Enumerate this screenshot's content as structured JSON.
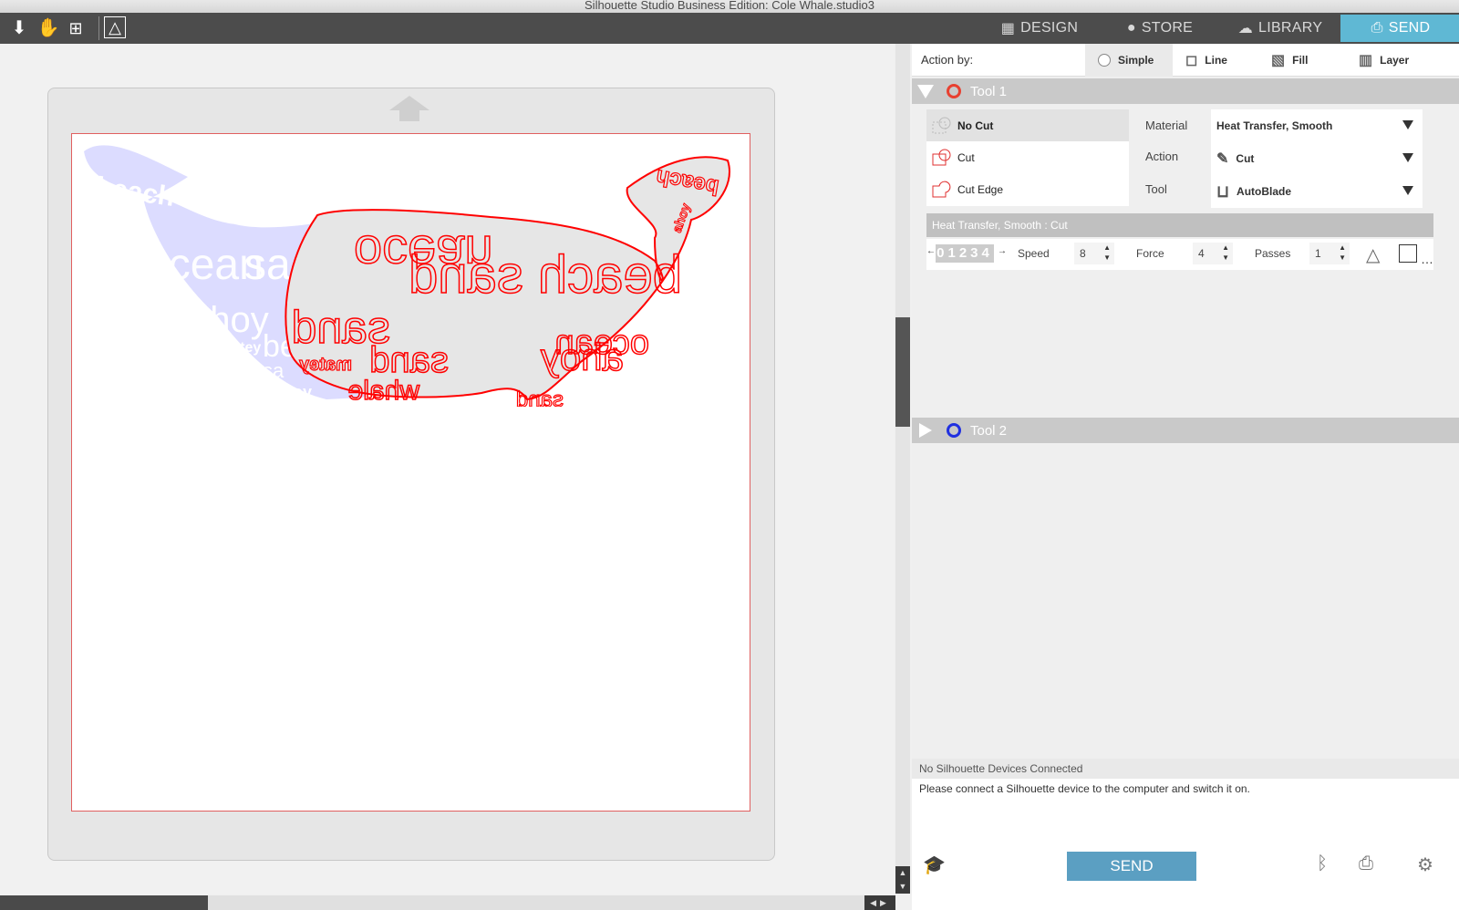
{
  "window": {
    "title": "Silhouette Studio Business Edition: Cole Whale.studio3"
  },
  "toolbar": {
    "icons": [
      "import-arrow-icon",
      "hand-pan-icon",
      "zoom-fit-icon",
      "design-grid-icon"
    ]
  },
  "nav": {
    "tabs": [
      {
        "label": "DESIGN",
        "icon": "grid-icon",
        "active": false
      },
      {
        "label": "STORE",
        "icon": "store-icon",
        "active": false
      },
      {
        "label": "LIBRARY",
        "icon": "cloud-icon",
        "active": false
      },
      {
        "label": "SEND",
        "icon": "cutter-icon",
        "active": true
      }
    ]
  },
  "canvas": {
    "whale_words_red": [
      "ocean",
      "beach sand",
      "ahoy",
      "sand",
      "ocean",
      "sand",
      "matey",
      "whale",
      "beach",
      "sand",
      "ahoy"
    ],
    "whale_words_ghost": [
      "beach",
      "sa",
      "ahoy",
      "matey",
      "be",
      "sa",
      "ahoy",
      "ahoy"
    ],
    "colors": {
      "cut_line": "#ff0000",
      "ghost": "#d9d9ff",
      "page_border": "#e06060"
    }
  },
  "panel": {
    "action_by": {
      "label": "Action by:",
      "options": [
        {
          "label": "Simple",
          "selected": true
        },
        {
          "label": "Line",
          "selected": false
        },
        {
          "label": "Fill",
          "selected": false
        },
        {
          "label": "Layer",
          "selected": false
        }
      ]
    },
    "tool1": {
      "label": "Tool 1",
      "color": "#e84030",
      "cut_options": [
        {
          "label": "No Cut",
          "selected": true
        },
        {
          "label": "Cut",
          "selected": false
        },
        {
          "label": "Cut Edge",
          "selected": false
        }
      ],
      "material_label": "Material",
      "material_value": "Heat Transfer, Smooth",
      "action_label": "Action",
      "action_value": "Cut",
      "tool_label": "Tool",
      "tool_value": "AutoBlade",
      "subheader": "Heat Transfer, Smooth : Cut",
      "depth_value": "01234",
      "speed_label": "Speed",
      "speed_value": "8",
      "force_label": "Force",
      "force_value": "4",
      "passes_label": "Passes",
      "passes_value": "1"
    },
    "tool2": {
      "label": "Tool 2",
      "color": "#2030e0"
    },
    "status": {
      "title": "No Silhouette Devices Connected",
      "message": "Please connect a Silhouette device to the computer and switch it on."
    },
    "send_label": "SEND"
  }
}
